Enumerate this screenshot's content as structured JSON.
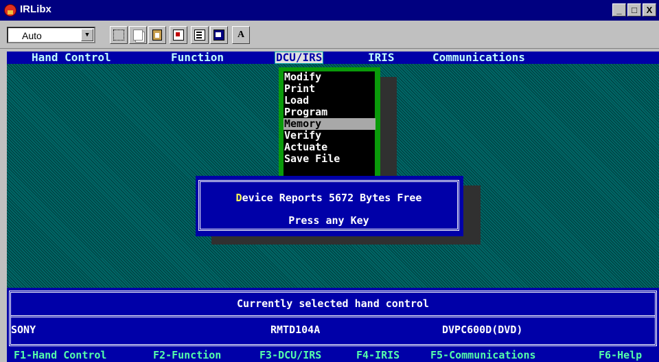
{
  "window": {
    "title": "IRLibx",
    "minimize": "_",
    "maximize": "□",
    "close": "X"
  },
  "toolbar": {
    "font_select_value": "Auto",
    "font_select_arrow": "▼",
    "font_button_label": "A"
  },
  "menubar": {
    "items": [
      {
        "label": "Hand Control"
      },
      {
        "label": "Function"
      },
      {
        "label": "DCU/IRS"
      },
      {
        "label": "IRIS"
      },
      {
        "label": "Communications"
      }
    ]
  },
  "dropdown": {
    "items": [
      {
        "label": "Modify"
      },
      {
        "label": "Print"
      },
      {
        "label": "Load"
      },
      {
        "label": "Program"
      },
      {
        "label": "Memory"
      },
      {
        "label": "Verify"
      },
      {
        "label": "Actuate"
      },
      {
        "label": "Save File"
      }
    ]
  },
  "dialog": {
    "message_first_letter": "D",
    "message_rest": "evice Reports 5672 Bytes Free",
    "prompt": "Press any Key"
  },
  "status": {
    "title": "Currently selected hand control",
    "manufacturer": "SONY",
    "remote_model": "RMTD104A",
    "device_model": "DVPC600D(DVD)"
  },
  "fkeys": [
    {
      "label": "F1-Hand Control"
    },
    {
      "label": "F2-Function"
    },
    {
      "label": "F3-DCU/IRS"
    },
    {
      "label": "F4-IRIS"
    },
    {
      "label": "F5-Communications"
    },
    {
      "label": "F6-Help"
    }
  ],
  "colors": {
    "titlebar": "#000080",
    "dos_background": "#006868",
    "dos_blue": "#0000a8",
    "menu_text": "#c0ffff",
    "dropdown_frame": "#0a9a0a",
    "fkey_text": "#55ffaa"
  }
}
